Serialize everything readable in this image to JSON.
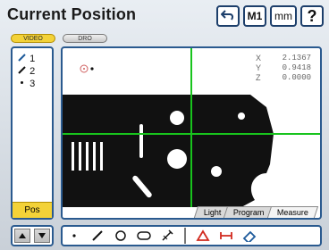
{
  "header": {
    "title": "Current Position",
    "buttons": {
      "undo_icon": "undo-icon",
      "m1_label": "M1",
      "mm_label": "mm",
      "help_label": "?"
    }
  },
  "modes": {
    "video_label": "VIDEO",
    "dro_label": "DRO"
  },
  "features": [
    {
      "icon": "line-icon",
      "label": "1"
    },
    {
      "icon": "line-icon",
      "label": "2"
    },
    {
      "icon": "dot-icon",
      "label": "3"
    }
  ],
  "left_panel": {
    "pos_label": "Pos"
  },
  "coords": {
    "x": {
      "label": "X",
      "value": "2.1367"
    },
    "y": {
      "label": "Y",
      "value": "0.9418"
    },
    "z": {
      "label": "Z",
      "value": "0.0000"
    }
  },
  "tabs": [
    {
      "label": "Light"
    },
    {
      "label": "Program"
    },
    {
      "label": "Measure"
    }
  ],
  "toolbar": {
    "tools": [
      "point-tool-icon",
      "line-tool-icon",
      "circle-tool-icon",
      "slot-tool-icon",
      "gage-tool-icon",
      "angle-tool-icon",
      "distance-tool-icon",
      "eraser-tool-icon"
    ]
  },
  "colors": {
    "accent": "#f3d238",
    "border": "#2a5a8f",
    "crosshair": "#18c41d",
    "part": "#111111"
  }
}
